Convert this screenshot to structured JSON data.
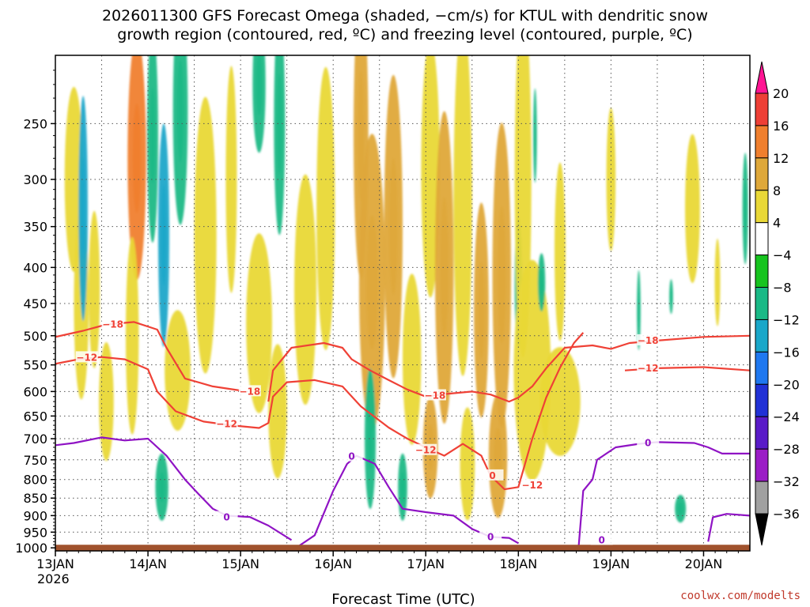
{
  "chart_data": {
    "type": "heatmap",
    "title_lines": [
      "2026011300 GFS Forecast Omega (shaded, −cm/s) for KTUL with dendritic snow",
      "growth region (contoured, red, ºC) and freezing level (contoured, purple, ºC)"
    ],
    "xlabel": "Forecast Time (UTC)",
    "credit": "coolwx.com/modelts",
    "x_start_label_year": "2026",
    "x_ticks": [
      {
        "day": 0,
        "label": "13JAN"
      },
      {
        "day": 1,
        "label": "14JAN"
      },
      {
        "day": 2,
        "label": "15JAN"
      },
      {
        "day": 3,
        "label": "16JAN"
      },
      {
        "day": 4,
        "label": "17JAN"
      },
      {
        "day": 5,
        "label": "18JAN"
      },
      {
        "day": 6,
        "label": "19JAN"
      },
      {
        "day": 7,
        "label": "20JAN"
      }
    ],
    "x_range_days": [
      0,
      7.5
    ],
    "y_ticks": [
      250,
      300,
      350,
      400,
      450,
      500,
      550,
      600,
      650,
      700,
      750,
      800,
      850,
      900,
      950,
      1000
    ],
    "y_range_hpa": [
      200,
      1010
    ],
    "colorbar": {
      "labels": [
        "20",
        "16",
        "12",
        "8",
        "4",
        "−4",
        "−8",
        "−12",
        "−16",
        "−20",
        "−24",
        "−28",
        "−32",
        "−36"
      ],
      "colors": [
        "#ff1493",
        "#ee3f36",
        "#f07f2e",
        "#dfa83a",
        "#e9d837",
        "#ffffff",
        "#17c41f",
        "#1ab986",
        "#1aa7c9",
        "#1f78f0",
        "#2131d6",
        "#5a1bc8",
        "#9b1cc6",
        "#a0a0a0",
        "#000000"
      ]
    },
    "omega_blobs": [
      {
        "t": 0.2,
        "p": 300,
        "w": 0.1,
        "h": 90,
        "v": 6
      },
      {
        "t": 0.28,
        "p": 450,
        "w": 0.08,
        "h": 140,
        "v": 5
      },
      {
        "t": 0.3,
        "p": 330,
        "w": 0.05,
        "h": 120,
        "v": -14
      },
      {
        "t": 0.42,
        "p": 430,
        "w": 0.06,
        "h": 110,
        "v": 5
      },
      {
        "t": 0.55,
        "p": 620,
        "w": 0.08,
        "h": 120,
        "v": 5
      },
      {
        "t": 0.88,
        "p": 280,
        "w": 0.1,
        "h": 110,
        "v": 12
      },
      {
        "t": 0.83,
        "p": 500,
        "w": 0.07,
        "h": 160,
        "v": 6
      },
      {
        "t": 1.05,
        "p": 260,
        "w": 0.06,
        "h": 90,
        "v": -8
      },
      {
        "t": 1.17,
        "p": 360,
        "w": 0.06,
        "h": 130,
        "v": -14
      },
      {
        "t": 1.15,
        "p": 820,
        "w": 0.07,
        "h": 90,
        "v": -8
      },
      {
        "t": 1.35,
        "p": 240,
        "w": 0.08,
        "h": 100,
        "v": -10
      },
      {
        "t": 1.32,
        "p": 560,
        "w": 0.14,
        "h": 110,
        "v": 5
      },
      {
        "t": 1.62,
        "p": 360,
        "w": 0.12,
        "h": 160,
        "v": 7
      },
      {
        "t": 1.9,
        "p": 300,
        "w": 0.06,
        "h": 110,
        "v": 5
      },
      {
        "t": 2.2,
        "p": 480,
        "w": 0.14,
        "h": 140,
        "v": 6
      },
      {
        "t": 2.2,
        "p": 220,
        "w": 0.07,
        "h": 60,
        "v": -8
      },
      {
        "t": 2.42,
        "p": 250,
        "w": 0.06,
        "h": 90,
        "v": -9
      },
      {
        "t": 2.4,
        "p": 640,
        "w": 0.1,
        "h": 140,
        "v": 5
      },
      {
        "t": 2.7,
        "p": 430,
        "w": 0.12,
        "h": 160,
        "v": 5
      },
      {
        "t": 2.92,
        "p": 330,
        "w": 0.1,
        "h": 150,
        "v": 7
      },
      {
        "t": 3.3,
        "p": 260,
        "w": 0.08,
        "h": 120,
        "v": 8
      },
      {
        "t": 3.42,
        "p": 420,
        "w": 0.14,
        "h": 200,
        "v": 9
      },
      {
        "t": 3.4,
        "p": 700,
        "w": 0.06,
        "h": 160,
        "v": -10
      },
      {
        "t": 3.65,
        "p": 350,
        "w": 0.1,
        "h": 170,
        "v": 8
      },
      {
        "t": 3.75,
        "p": 820,
        "w": 0.05,
        "h": 90,
        "v": -8
      },
      {
        "t": 3.85,
        "p": 540,
        "w": 0.1,
        "h": 150,
        "v": 6
      },
      {
        "t": 4.05,
        "p": 290,
        "w": 0.1,
        "h": 120,
        "v": 5
      },
      {
        "t": 4.05,
        "p": 720,
        "w": 0.08,
        "h": 120,
        "v": 10
      },
      {
        "t": 4.2,
        "p": 400,
        "w": 0.1,
        "h": 200,
        "v": 8
      },
      {
        "t": 4.4,
        "p": 320,
        "w": 0.1,
        "h": 180,
        "v": 7
      },
      {
        "t": 4.45,
        "p": 760,
        "w": 0.08,
        "h": 140,
        "v": 6
      },
      {
        "t": 4.6,
        "p": 460,
        "w": 0.08,
        "h": 160,
        "v": 10
      },
      {
        "t": 4.82,
        "p": 410,
        "w": 0.1,
        "h": 200,
        "v": 9
      },
      {
        "t": 4.78,
        "p": 740,
        "w": 0.1,
        "h": 150,
        "v": 8
      },
      {
        "t": 5.0,
        "p": 420,
        "w": 0.04,
        "h": 90,
        "v": -8
      },
      {
        "t": 5.05,
        "p": 300,
        "w": 0.09,
        "h": 170,
        "v": 6
      },
      {
        "t": 5.15,
        "p": 560,
        "w": 0.2,
        "h": 200,
        "v": 5
      },
      {
        "t": 5.18,
        "p": 260,
        "w": 0.02,
        "h": 40,
        "v": -8
      },
      {
        "t": 5.25,
        "p": 420,
        "w": 0.04,
        "h": 40,
        "v": -8
      },
      {
        "t": 5.45,
        "p": 380,
        "w": 0.06,
        "h": 110,
        "v": 5
      },
      {
        "t": 5.45,
        "p": 620,
        "w": 0.22,
        "h": 110,
        "v": 5
      },
      {
        "t": 6.0,
        "p": 300,
        "w": 0.05,
        "h": 70,
        "v": 5
      },
      {
        "t": 6.3,
        "p": 460,
        "w": 0.02,
        "h": 60,
        "v": -8
      },
      {
        "t": 6.65,
        "p": 440,
        "w": 0.02,
        "h": 25,
        "v": -8
      },
      {
        "t": 6.75,
        "p": 880,
        "w": 0.06,
        "h": 40,
        "v": -8
      },
      {
        "t": 6.88,
        "p": 330,
        "w": 0.08,
        "h": 80,
        "v": 5
      },
      {
        "t": 7.15,
        "p": 420,
        "w": 0.03,
        "h": 60,
        "v": 5
      },
      {
        "t": 7.45,
        "p": 330,
        "w": 0.03,
        "h": 60,
        "v": -8
      }
    ],
    "contour_neg18": [
      [
        [
          0,
          502
        ],
        [
          0.3,
          492
        ],
        [
          0.55,
          482
        ],
        [
          0.85,
          478
        ],
        [
          1.1,
          490
        ],
        [
          1.2,
          520
        ],
        [
          1.4,
          575
        ],
        [
          1.7,
          590
        ],
        [
          2.0,
          598
        ]
      ],
      [
        [
          2.3,
          620
        ],
        [
          2.35,
          560
        ],
        [
          2.55,
          520
        ],
        [
          2.9,
          512
        ],
        [
          3.1,
          520
        ],
        [
          3.2,
          540
        ],
        [
          3.4,
          560
        ],
        [
          3.6,
          578
        ],
        [
          3.8,
          596
        ],
        [
          4.0,
          610
        ],
        [
          4.2,
          605
        ],
        [
          4.5,
          600
        ],
        [
          4.7,
          606
        ],
        [
          4.9,
          620
        ],
        [
          5.0,
          612
        ],
        [
          5.15,
          590
        ],
        [
          5.3,
          556
        ],
        [
          5.5,
          520
        ],
        [
          5.8,
          516
        ],
        [
          6.0,
          522
        ],
        [
          6.2,
          512
        ],
        [
          6.5,
          508
        ],
        [
          7.0,
          502
        ],
        [
          7.5,
          500
        ]
      ]
    ],
    "contour_neg12": [
      [
        [
          0,
          548
        ],
        [
          0.25,
          540
        ],
        [
          0.5,
          536
        ],
        [
          0.75,
          540
        ],
        [
          1.0,
          558
        ],
        [
          1.1,
          600
        ],
        [
          1.3,
          640
        ],
        [
          1.6,
          662
        ],
        [
          1.9,
          670
        ],
        [
          2.2,
          676
        ],
        [
          2.3,
          665
        ],
        [
          2.35,
          610
        ],
        [
          2.5,
          582
        ],
        [
          2.8,
          578
        ],
        [
          3.1,
          590
        ],
        [
          3.3,
          630
        ],
        [
          3.6,
          675
        ],
        [
          3.8,
          700
        ],
        [
          4.0,
          720
        ],
        [
          4.2,
          740
        ],
        [
          4.4,
          712
        ],
        [
          4.6,
          740
        ],
        [
          4.7,
          790
        ],
        [
          4.85,
          826
        ],
        [
          5.0,
          820
        ],
        [
          5.15,
          700
        ],
        [
          5.3,
          612
        ],
        [
          5.45,
          555
        ],
        [
          5.6,
          512
        ],
        [
          5.7,
          495
        ]
      ]
    ],
    "contour_neg12_right": [
      [
        6.15,
        560
      ],
      [
        6.5,
        556
      ],
      [
        7.0,
        554
      ],
      [
        7.5,
        560
      ]
    ],
    "contour_zero": [
      [
        [
          0,
          715
        ],
        [
          0.2,
          710
        ],
        [
          0.5,
          697
        ],
        [
          0.75,
          704
        ],
        [
          1.0,
          700
        ],
        [
          1.2,
          740
        ],
        [
          1.4,
          800
        ],
        [
          1.55,
          840
        ],
        [
          1.7,
          880
        ],
        [
          1.85,
          900
        ],
        [
          2.1,
          904
        ],
        [
          2.3,
          930
        ],
        [
          2.55,
          975
        ]
      ],
      [
        [
          2.6,
          1000
        ],
        [
          2.8,
          960
        ],
        [
          3.0,
          830
        ],
        [
          3.15,
          760
        ],
        [
          3.25,
          740
        ],
        [
          3.45,
          760
        ],
        [
          3.6,
          820
        ],
        [
          3.75,
          880
        ],
        [
          4.0,
          890
        ],
        [
          4.3,
          900
        ],
        [
          4.5,
          940
        ],
        [
          4.7,
          965
        ],
        [
          4.9,
          968
        ],
        [
          5.0,
          985
        ]
      ],
      [
        [
          5.65,
          1000
        ],
        [
          5.7,
          830
        ],
        [
          5.8,
          800
        ],
        [
          5.85,
          750
        ],
        [
          6.05,
          720
        ],
        [
          6.3,
          712
        ],
        [
          6.5,
          708
        ],
        [
          6.9,
          710
        ],
        [
          7.05,
          720
        ],
        [
          7.2,
          735
        ],
        [
          7.5,
          735
        ]
      ],
      [
        [
          7.05,
          980
        ],
        [
          7.1,
          905
        ],
        [
          7.25,
          895
        ],
        [
          7.5,
          900
        ]
      ]
    ],
    "contour_labels": [
      {
        "t": 0.62,
        "p": 482,
        "text": "−18",
        "color": "red"
      },
      {
        "t": 0.34,
        "p": 537,
        "text": "−12",
        "color": "red"
      },
      {
        "t": 2.1,
        "p": 600,
        "text": "−18",
        "color": "red"
      },
      {
        "t": 1.85,
        "p": 667,
        "text": "−12",
        "color": "red"
      },
      {
        "t": 4.1,
        "p": 608,
        "text": "−18",
        "color": "red"
      },
      {
        "t": 4.0,
        "p": 727,
        "text": "−12",
        "color": "red"
      },
      {
        "t": 4.72,
        "p": 790,
        "text": "0",
        "color": "red"
      },
      {
        "t": 5.15,
        "p": 815,
        "text": "−12",
        "color": "red"
      },
      {
        "t": 6.4,
        "p": 508,
        "text": "−18",
        "color": "red"
      },
      {
        "t": 6.4,
        "p": 556,
        "text": "−12",
        "color": "red"
      },
      {
        "t": 1.85,
        "p": 905,
        "text": "0",
        "color": "purple"
      },
      {
        "t": 3.2,
        "p": 742,
        "text": "0",
        "color": "purple"
      },
      {
        "t": 4.7,
        "p": 965,
        "text": "0",
        "color": "purple"
      },
      {
        "t": 5.9,
        "p": 975,
        "text": "0",
        "color": "purple"
      },
      {
        "t": 6.4,
        "p": 710,
        "text": "0",
        "color": "purple"
      }
    ],
    "ground": {
      "p_top": 990,
      "color": "#a0522d"
    },
    "colors": {
      "dgz_contour": "#ef4136",
      "freezing_contour": "#8f13c4",
      "grid": "#555555"
    }
  }
}
